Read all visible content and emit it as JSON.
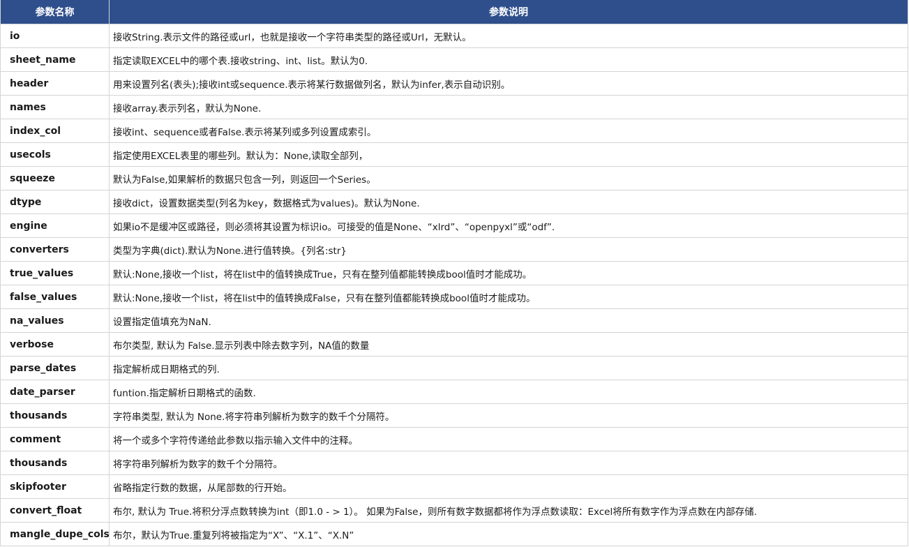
{
  "headers": [
    "参数名称",
    "参数说明"
  ],
  "rows": [
    {
      "name": "io",
      "desc": "接收String.表示文件的路径或url，也就是接收一个字符串类型的路径或Url，无默认。"
    },
    {
      "name": "sheet_name",
      "desc": "指定读取EXCEL中的哪个表.接收string、int、list。默认为0."
    },
    {
      "name": "header",
      "desc": "用来设置列名(表头);接收int或sequence.表示将某行数据做列名，默认为infer,表示自动识别。"
    },
    {
      "name": "names",
      "desc": "接收array.表示列名，默认为None."
    },
    {
      "name": "index_col",
      "desc": "接收int、sequence或者False.表示将某列或多列设置成索引。"
    },
    {
      "name": "usecols",
      "desc": "指定使用EXCEL表里的哪些列。默认为：None,读取全部列，"
    },
    {
      "name": "squeeze",
      "desc": "默认为False,如果解析的数据只包含一列，则返回一个Series。"
    },
    {
      "name": "dtype",
      "desc": "接收dict，设置数据类型(列名为key，数据格式为values)。默认为None."
    },
    {
      "name": "engine",
      "desc": "如果io不是缓冲区或路径，则必须将其设置为标识io。可接受的值是None、“xlrd”、“openpyxl”或“odf”."
    },
    {
      "name": "converters",
      "desc": "类型为字典(dict).默认为None.进行值转换。{列名:str}"
    },
    {
      "name": "true_values",
      "desc": "默认:None,接收一个list，将在list中的值转换成True，只有在整列值都能转换成bool值时才能成功。"
    },
    {
      "name": "false_values",
      "desc": "默认:None,接收一个list，将在list中的值转换成False，只有在整列值都能转换成bool值时才能成功。"
    },
    {
      "name": "na_values",
      "desc": "设置指定值填充为NaN."
    },
    {
      "name": "verbose",
      "desc": "布尔类型, 默认为 False.显示列表中除去数字列，NA值的数量"
    },
    {
      "name": "parse_dates",
      "desc": "指定解析成日期格式的列."
    },
    {
      "name": "date_parser",
      "desc": "funtion.指定解析日期格式的函数."
    },
    {
      "name": "thousands",
      "desc": "字符串类型, 默认为 None.将字符串列解析为数字的数千个分隔符。"
    },
    {
      "name": "comment",
      "desc": "将一个或多个字符传递给此参数以指示输入文件中的注释。"
    },
    {
      "name": "thousands",
      "desc": "将字符串列解析为数字的数千个分隔符。"
    },
    {
      "name": "skipfooter",
      "desc": "省略指定行数的数据，从尾部数的行开始。"
    },
    {
      "name": "convert_float",
      "desc": "布尔, 默认为 True.将积分浮点数转换为int（即1.0 - > 1）。 如果为False，则所有数字数据都将作为浮点数读取：Excel将所有数字作为浮点数在内部存储."
    },
    {
      "name": "mangle_dupe_cols",
      "desc": "布尔，默认为True.重复列将被指定为“X”、“X.1”、“X.N”"
    }
  ],
  "colors": {
    "header_bg": "#2e4f8c",
    "header_text": "#ffffff",
    "border": "#d4d4d4"
  }
}
